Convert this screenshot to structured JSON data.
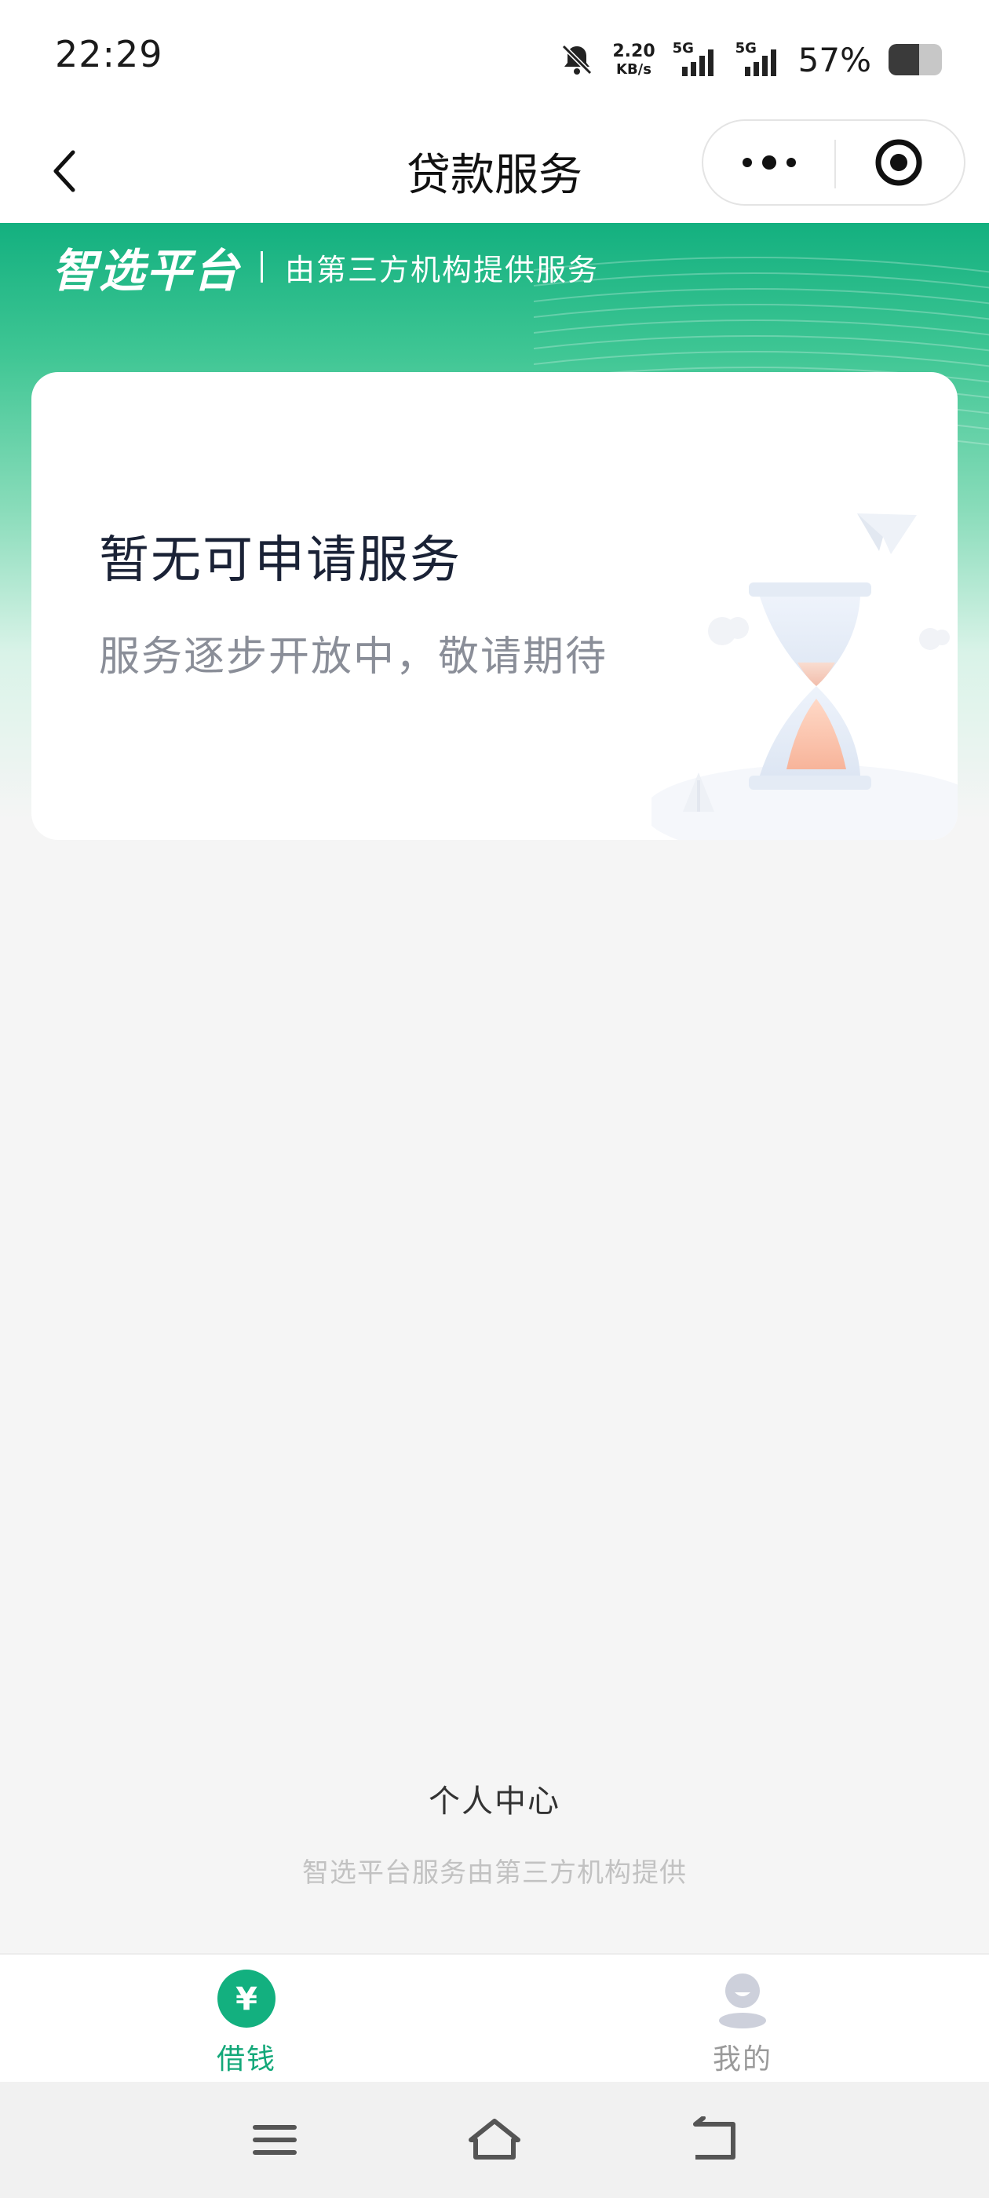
{
  "status_bar": {
    "time": "22:29",
    "net_speed_value": "2.20",
    "net_speed_unit": "KB/s",
    "sim1_label": "5G",
    "sim2_label": "5G",
    "battery_percent_text": "57%",
    "battery_level": 0.57
  },
  "nav": {
    "title": "贷款服务"
  },
  "brand": {
    "logo_text": "智选平台",
    "subtitle": "由第三方机构提供服务"
  },
  "card": {
    "title": "暂无可申请服务",
    "subtitle": "服务逐步开放中，敬请期待"
  },
  "footer": {
    "personal_center": "个人中心",
    "provider_note": "智选平台服务由第三方机构提供"
  },
  "tabs": [
    {
      "label": "借钱",
      "icon": "yuan-icon",
      "active": true
    },
    {
      "label": "我的",
      "icon": "user-icon",
      "active": false
    }
  ],
  "colors": {
    "brand_green": "#13b07f",
    "active_tab": "#13a879",
    "inactive_tab": "#9a9a9a",
    "page_bg": "#f5f5f5"
  }
}
